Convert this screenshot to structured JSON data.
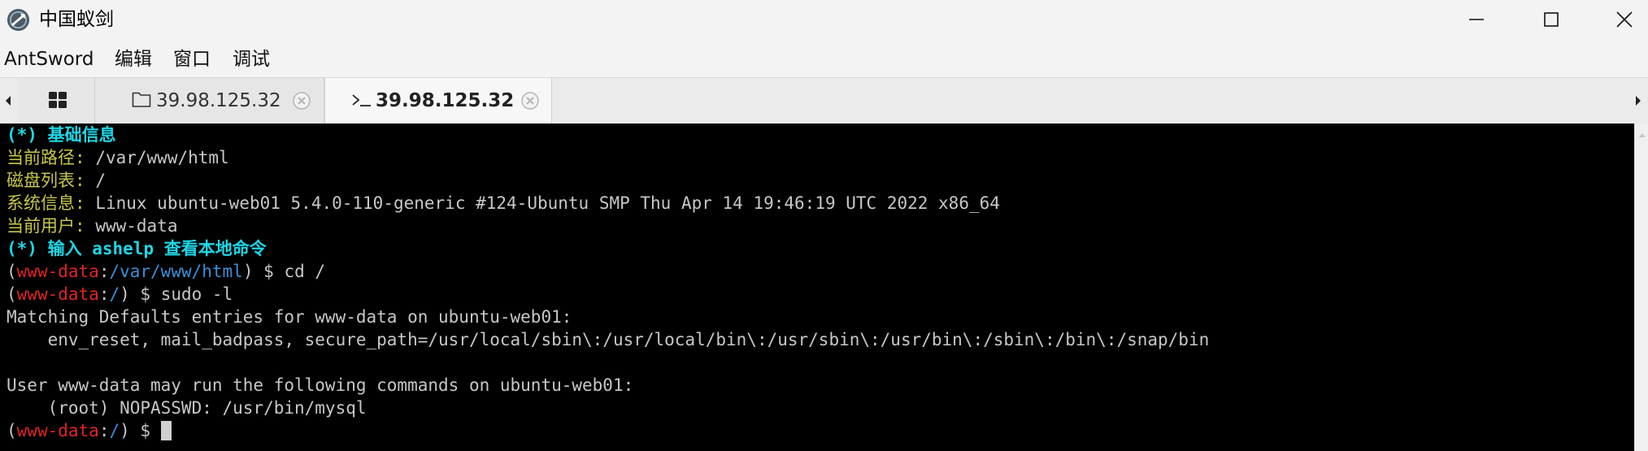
{
  "window": {
    "title": "中国蚁剑"
  },
  "menu": {
    "items": [
      "AntSword",
      "编辑",
      "窗口",
      "调试"
    ]
  },
  "tabs": {
    "file_tab_label": "39.98.125.32",
    "terminal_tab_label": "39.98.125.32"
  },
  "terminal": {
    "info_header_mark": "(*)",
    "info_header_text": "基础信息",
    "current_path_key": "当前路径:",
    "current_path_value": "/var/www/html",
    "disk_list_key": "磁盘列表:",
    "disk_list_value": "/",
    "system_info_key": "系统信息:",
    "system_info_value": "Linux ubuntu-web01 5.4.0-110-generic #124-Ubuntu SMP Thu Apr 14 19:46:19 UTC 2022 x86_64",
    "current_user_key": "当前用户:",
    "current_user_value": "www-data",
    "help_hint_mark": "(*)",
    "help_hint_text": "输入 ashelp 查看本地命令",
    "prompt_open": "(",
    "prompt_user": "www-data",
    "prompt_colon": ":",
    "prompt_close": ") $",
    "cmd1_path": "/var/www/html",
    "cmd1": "cd /",
    "cmd2_path": "/",
    "cmd2": "sudo -l",
    "output_line1": "Matching Defaults entries for www-data on ubuntu-web01:",
    "output_line2": "    env_reset, mail_badpass, secure_path=/usr/local/sbin\\:/usr/local/bin\\:/usr/sbin\\:/usr/bin\\:/sbin\\:/bin\\:/snap/bin",
    "output_line3": "User www-data may run the following commands on ubuntu-web01:",
    "output_line4": "    (root) NOPASSWD: /usr/bin/mysql",
    "cmd3_path": "/"
  },
  "colors": {
    "terminal_bg": "#000000",
    "header_cyan": "#1ed6e6",
    "key_yellow": "#c9c74c",
    "prompt_red": "#e02424",
    "path_blue": "#3b8fd6"
  },
  "icons": {
    "app": "antsword-logo-icon",
    "home_tab": "grid-icon",
    "file_tab": "folder-icon",
    "terminal_tab": "terminal-prompt-icon",
    "tab_close": "close-circle-icon"
  }
}
